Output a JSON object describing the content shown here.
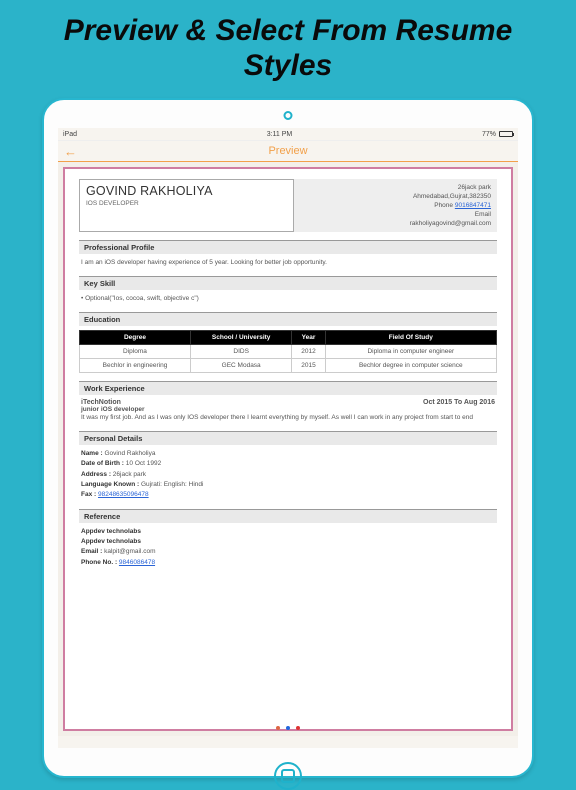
{
  "promo": {
    "line1": "Preview & Select From Resume",
    "line2": "Styles"
  },
  "status": {
    "carrier": "iPad",
    "wifi": "wifi-icon",
    "time": "3:11 PM",
    "battery_pct": "77%"
  },
  "nav": {
    "title": "Preview",
    "back": "←"
  },
  "resume": {
    "name": "GOVIND RAKHOLIYA",
    "role": "IOS DEVELOPER",
    "addr1": "26jack park",
    "addr2": "Ahmedabad,Gujrat,382350",
    "phone_lbl": "Phone",
    "phone": "9016847471",
    "email_lbl": "Email",
    "email": "rakholiyagovind@gmail.com",
    "sec_profile": "Professional Profile",
    "profile_txt": "I am an iOS developer having experience of 5 year. Looking for better job opportunity.",
    "sec_skill": "Key Skill",
    "skill": "Optional(\"Ios, cocoa, swift, objective c\")",
    "sec_edu": "Education",
    "edu_headers": [
      "Degree",
      "School / University",
      "Year",
      "Field Of Study"
    ],
    "edu_rows": [
      [
        "Diploma",
        "DIDS",
        "2012",
        "Diploma in computer engineer"
      ],
      [
        "Bechlor in engineering",
        "GEC Modasa",
        "2015",
        "Bechlor degree in computer science"
      ]
    ],
    "sec_exp": "Work Experience",
    "exp_company": "iTechNotion",
    "exp_date": "Oct 2015 To Aug 2016",
    "exp_title": "junior iOS developer",
    "exp_desc": "It was my first job. And as I was only IOS developer there I learnt everything by myself. As well I can work in any project from start to end",
    "sec_personal": "Personal Details",
    "pd_name_k": "Name :",
    "pd_name_v": "Govind Rakholiya",
    "pd_dob_k": "Date of Birth :",
    "pd_dob_v": "10 Oct 1992",
    "pd_addr_k": "Address :",
    "pd_addr_v": "26jack park",
    "pd_lang_k": "Language Known :",
    "pd_lang_v": "Gujrati: English: Hindi",
    "pd_fax_k": "Fax :",
    "pd_fax_v": "98248635096478",
    "sec_ref": "Reference",
    "ref1": "Appdev technolabs",
    "ref2": "Appdev technolabs",
    "ref_email_k": "Email :",
    "ref_email_v": "kalpit@gmail.com",
    "ref_phone_k": "Phone No. :",
    "ref_phone_v": "9846086478"
  }
}
